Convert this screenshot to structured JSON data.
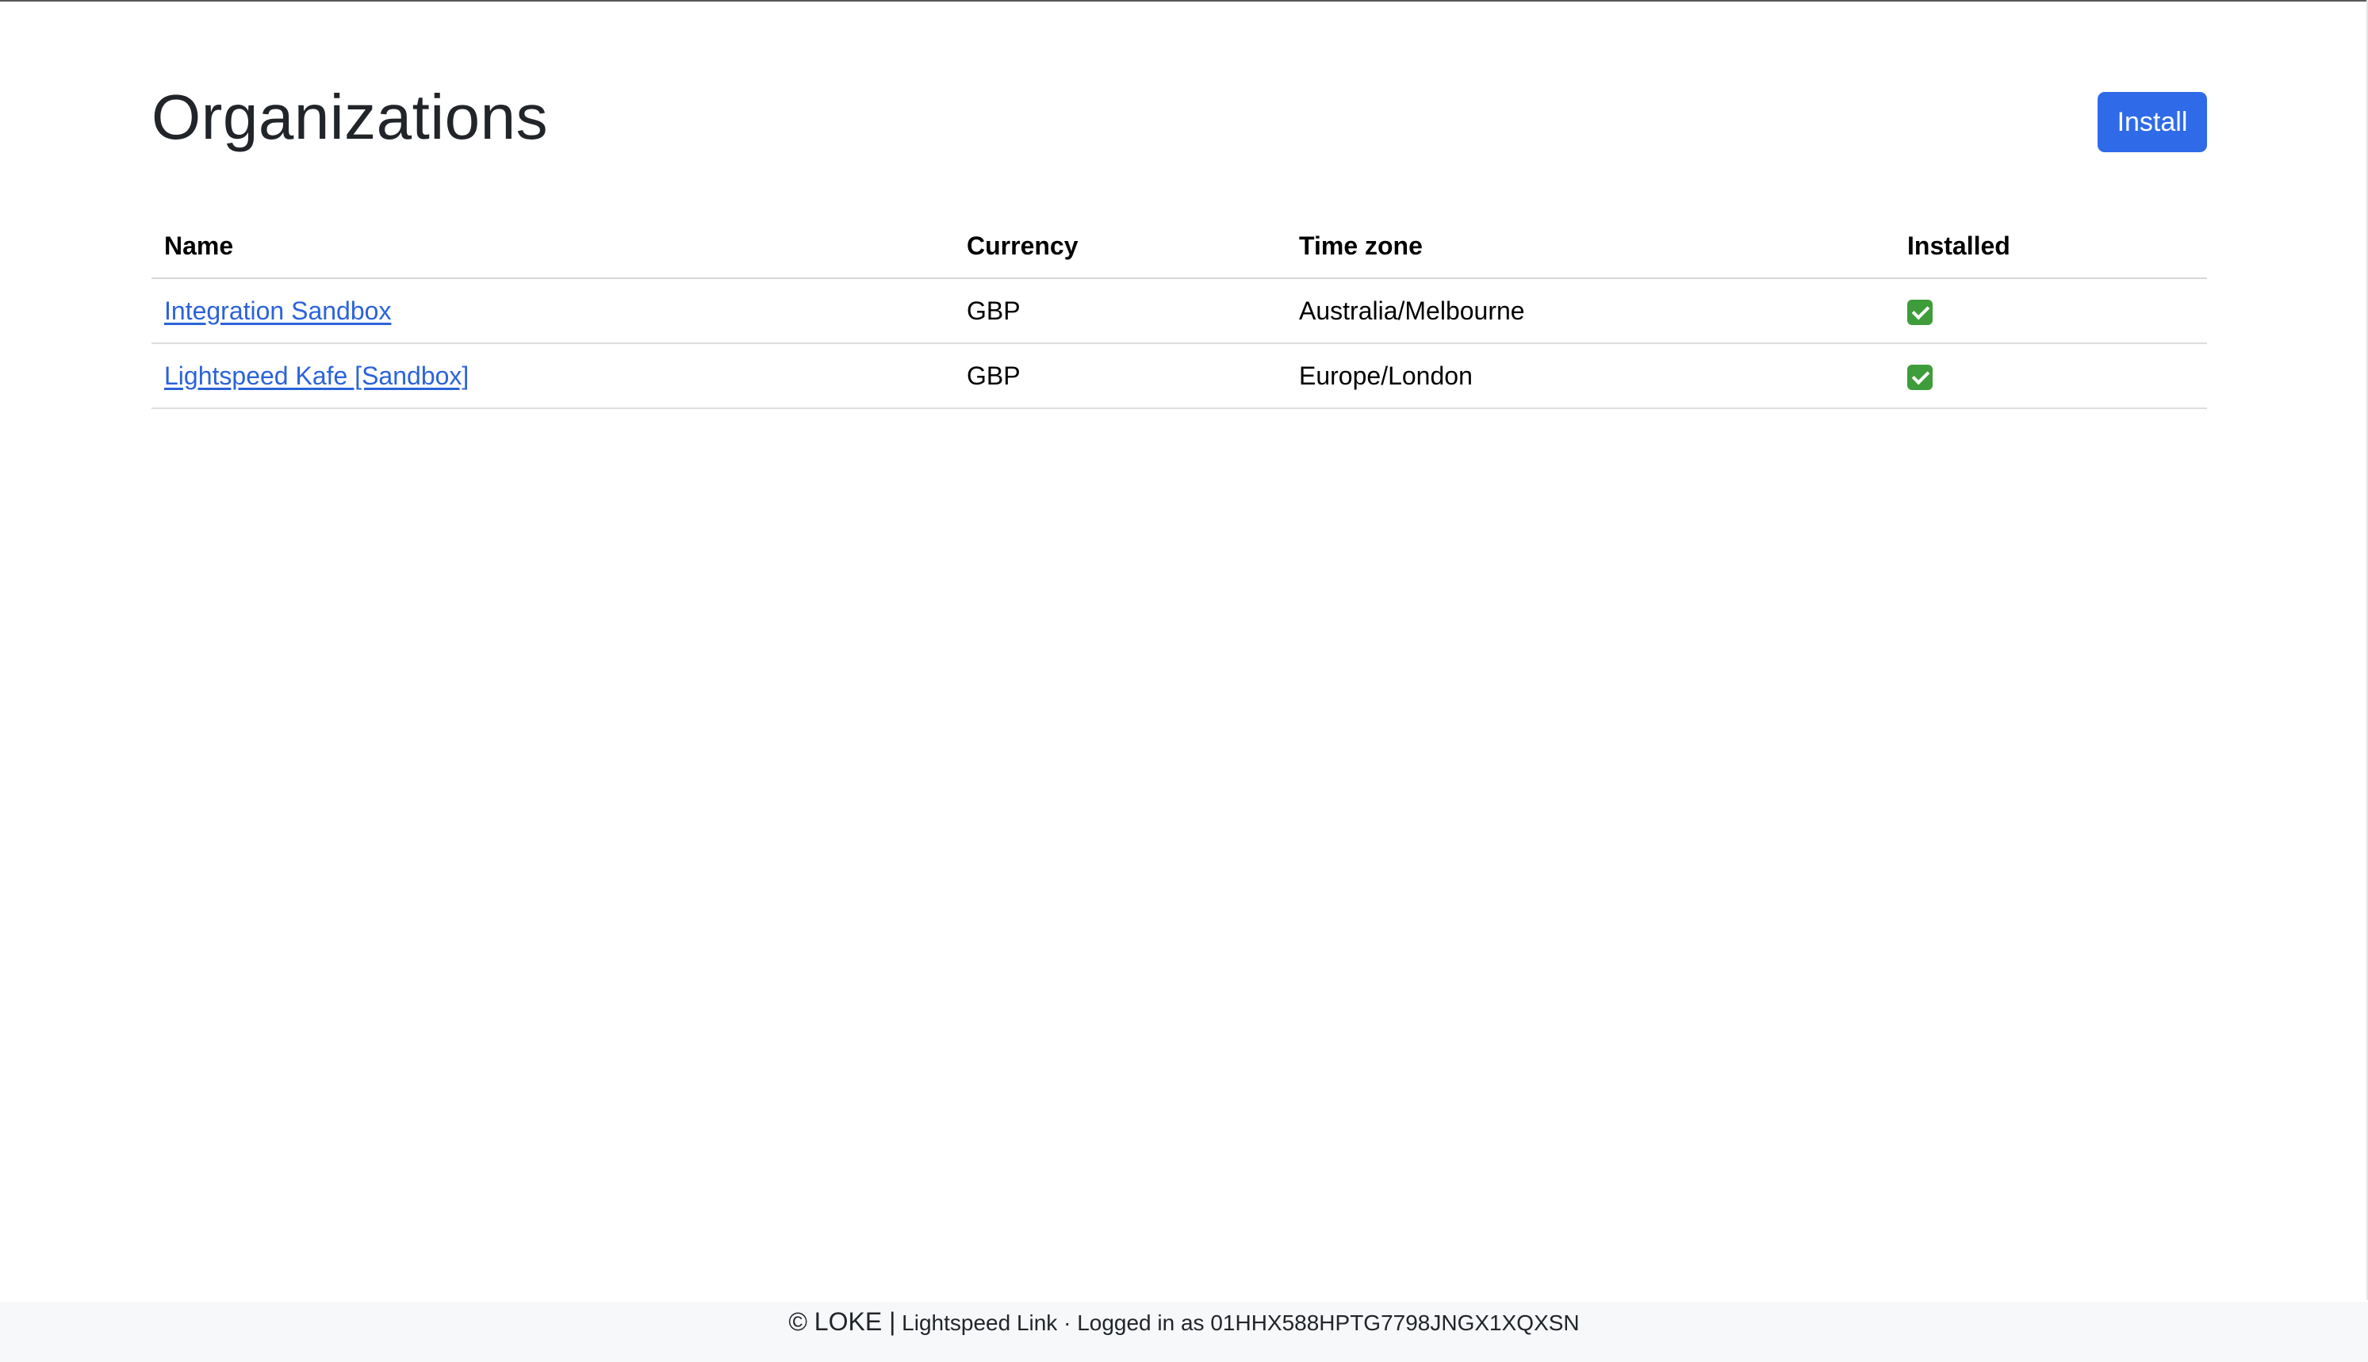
{
  "page": {
    "title": "Organizations",
    "install_label": "Install"
  },
  "table": {
    "headers": [
      "Name",
      "Currency",
      "Time zone",
      "Installed"
    ],
    "rows": [
      {
        "name": "Integration Sandbox",
        "currency": "GBP",
        "timezone": "Australia/Melbourne",
        "installed_icon": "check-icon"
      },
      {
        "name": "Lightspeed Kafe [Sandbox]",
        "currency": "GBP",
        "timezone": "Europe/London",
        "installed_icon": "check-icon"
      }
    ]
  },
  "footer": {
    "brand": "© LOKE |",
    "text": "Lightspeed Link · Logged in as 01HHX588HPTG7798JNGX1XQXSN"
  },
  "colors": {
    "accent": "#2f6ae8",
    "link": "#2b63d9",
    "check": "#3f9c3a"
  }
}
